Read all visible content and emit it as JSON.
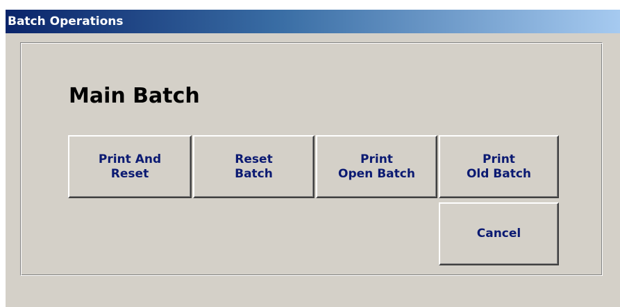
{
  "window": {
    "title": "Batch Operations"
  },
  "group": {
    "heading": "Main Batch"
  },
  "buttons": {
    "print_and_reset": "Print And\nReset",
    "reset_batch": "Reset\nBatch",
    "print_open_batch": "Print\nOpen Batch",
    "print_old_batch": "Print\nOld Batch",
    "cancel": "Cancel"
  },
  "colors": {
    "titlebar_start": "#0a246a",
    "titlebar_end": "#a6caf0",
    "window_bg": "#d4d0c8",
    "button_text": "#0b1a72"
  }
}
